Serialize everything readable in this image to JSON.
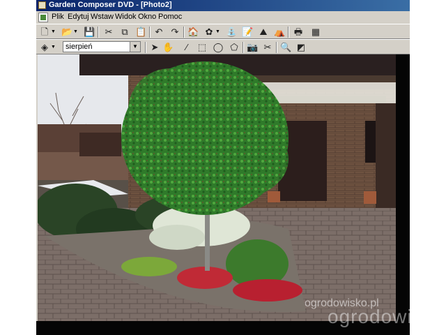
{
  "window": {
    "title": "Garden Composer DVD - [Photo2]"
  },
  "menu": [
    "Plik",
    "Edytuj",
    "Wstaw",
    "Widok",
    "Okno",
    "Pomoc"
  ],
  "toolbar_top": {
    "icons": [
      "new-document-icon",
      "open-folder-icon",
      "save-icon",
      "cut-icon",
      "copy-icon",
      "paste-icon",
      "undo-icon",
      "redo-icon",
      "house-icon",
      "plant-icon",
      "watering-can-icon",
      "notes-icon",
      "terrain-icon",
      "tent-icon",
      "print-icon",
      "calculator-icon"
    ]
  },
  "toolbar_bottom": {
    "month_select": {
      "value": "sierpień"
    },
    "icons": [
      "layer-icon",
      "pointer-arrow-icon",
      "hand-icon",
      "magic-wand-icon",
      "rect-select-icon",
      "lasso-icon",
      "polygon-select-icon",
      "camera-icon",
      "prune-icon",
      "zoom-icon",
      "fill-icon"
    ]
  },
  "watermark": {
    "small": "ogrodowisko.pl",
    "large": "ogrodowisk"
  }
}
